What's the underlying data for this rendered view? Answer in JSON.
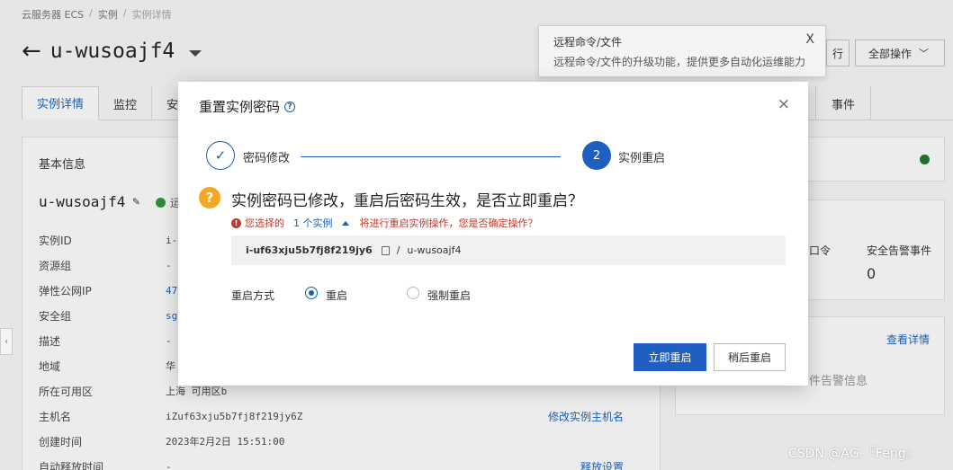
{
  "breadcrumb": [
    "云服务器 ECS",
    "实例",
    "实例详情"
  ],
  "instance": {
    "title": "u-wusoajf4",
    "name": "u-wusoajf4",
    "status_partial": "运"
  },
  "header_buttons": {
    "partial_label": "行",
    "all_actions": "全部操作"
  },
  "tabs": [
    "实例详情",
    "监控",
    "安"
  ],
  "tab_event": "事件",
  "basic_info": {
    "header": "基本信息",
    "rows": [
      {
        "key": "实例ID",
        "value": "i-u"
      },
      {
        "key": "资源组",
        "value": "-"
      },
      {
        "key": "弹性公网IP",
        "value": "47."
      },
      {
        "key": "安全组",
        "value": "sg-"
      },
      {
        "key": "描述",
        "value": "-"
      },
      {
        "key": "地域",
        "value": "华"
      },
      {
        "key": "所在可用区",
        "value": "上海 可用区b"
      },
      {
        "key": "主机名",
        "value": "iZuf63xju5b7fj8f219jy6Z",
        "action": "修改实例主机名"
      },
      {
        "key": "创建时间",
        "value": "2023年2月2日 15:51:00"
      },
      {
        "key": "自动释放时间",
        "value": "-",
        "action": "释放设置"
      }
    ]
  },
  "right_cards": {
    "card2_label1": "口令",
    "card2_label2": "安全告警事件",
    "card2_value": "0",
    "card3_link": "查看详情",
    "card3_text": "件告警信息"
  },
  "tooltip": {
    "title": "远程命令/文件",
    "body": "远程命令/文件的升级功能，提供更多自动化运维能力",
    "close": "X"
  },
  "modal": {
    "title": "重置实例密码",
    "close": "×",
    "steps": [
      {
        "label": "密码修改",
        "state": "done"
      },
      {
        "label": "实例重启",
        "number": "2",
        "state": "active"
      }
    ],
    "question": "实例密码已修改，重启后密码生效，是否立即重启？",
    "warning": {
      "prefix": "您选择的",
      "count_link": "1 个实例",
      "suffix": "将进行重启实例操作，您是否确定操作？"
    },
    "instance_id": "i-uf63xju5b7fj8f219jy6",
    "instance_sep": "/",
    "instance_name": "u-wusoajf4",
    "reboot_mode_label": "重启方式",
    "radio_options": [
      {
        "label": "重启",
        "checked": true
      },
      {
        "label": "强制重启",
        "checked": false
      }
    ],
    "primary_button": "立即重启",
    "secondary_button": "稍后重启"
  },
  "watermark": "CSDN @AG.『Feng』",
  "colors": {
    "primary": "#1f5fc2",
    "link": "#1a5fb4",
    "warning_red": "#c0392b",
    "question_orange": "#f5a623",
    "running_green": "#2e8b3a"
  }
}
